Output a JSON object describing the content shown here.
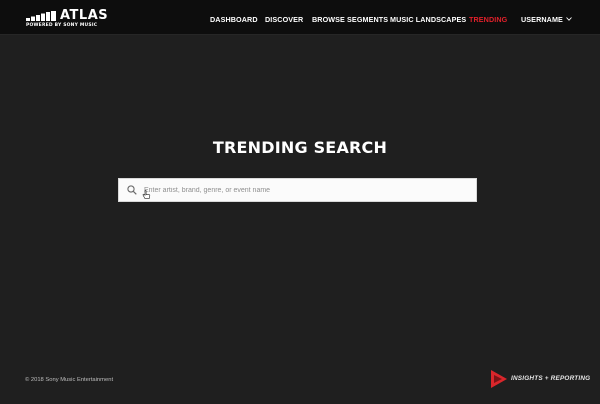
{
  "header": {
    "logo_text": "ATLAS",
    "logo_subtext": "POWERED BY SONY MUSIC",
    "nav": [
      {
        "label": "DASHBOARD",
        "active": false
      },
      {
        "label": "DISCOVER",
        "active": false
      },
      {
        "label": "BROWSE SEGMENTS",
        "active": false
      },
      {
        "label": "MUSIC LANDSCAPES",
        "active": false
      },
      {
        "label": "TRENDING",
        "active": true
      },
      {
        "label": "USERNAME",
        "active": false
      }
    ],
    "active_color": "#e0202a"
  },
  "main": {
    "title": "TRENDING SEARCH",
    "search": {
      "placeholder": "Enter artist, brand, genre, or event name",
      "value": "",
      "icon": "search-icon"
    }
  },
  "footer": {
    "copyright": "© 2018 Sony Music Entertainment",
    "brand_text": "INSIGHTS + REPORTING",
    "brand_icon": "play-triangle-icon",
    "brand_color": "#d9262b"
  },
  "colors": {
    "background": "#1f1f1f",
    "topbar": "#0d0d0d"
  }
}
